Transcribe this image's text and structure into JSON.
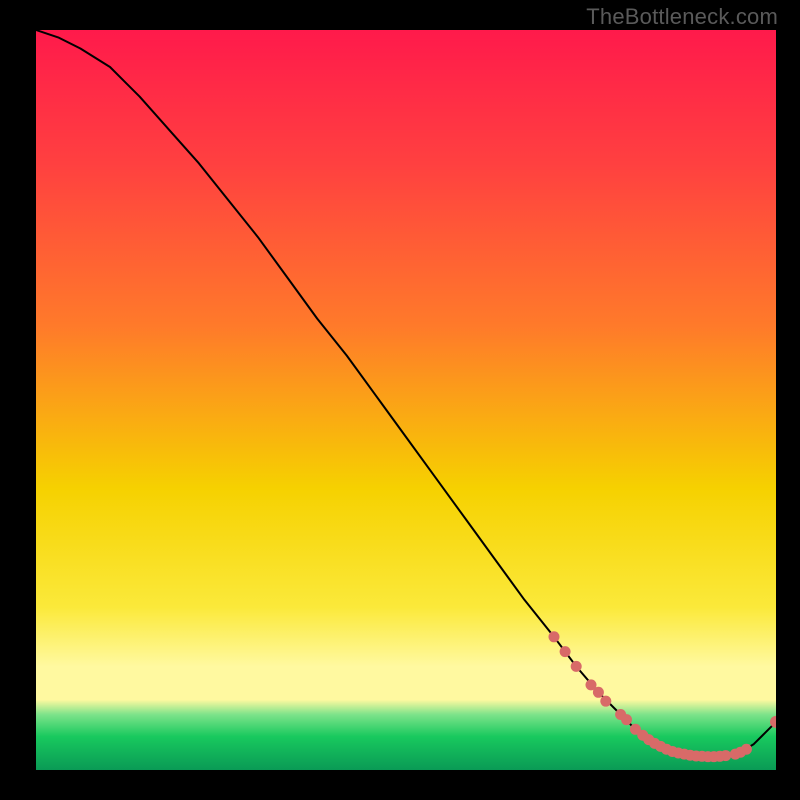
{
  "watermark": "TheBottleneck.com",
  "colors": {
    "background": "#000000",
    "line": "#000000",
    "point_fill": "#d86a68",
    "point_stroke": "#d86a68",
    "gradient_top": "#ff1a4b",
    "gradient_mid1": "#ff7a2a",
    "gradient_mid2": "#f6d100",
    "gradient_mid3": "#fff43a",
    "gradient_band": "#fff9a0",
    "gradient_green1": "#7de38a",
    "gradient_green2": "#18c95e",
    "gradient_green3": "#0a9a55"
  },
  "chart_data": {
    "type": "line",
    "title": "",
    "xlabel": "",
    "ylabel": "",
    "xlim": [
      0,
      100
    ],
    "ylim": [
      0,
      100
    ],
    "grid": false,
    "legend": false,
    "series": [
      {
        "name": "curve",
        "x": [
          0,
          3,
          6,
          10,
          14,
          18,
          22,
          26,
          30,
          34,
          38,
          42,
          46,
          50,
          54,
          58,
          62,
          66,
          70,
          73,
          76,
          79,
          81,
          83,
          85,
          87,
          89,
          91,
          93,
          95,
          97,
          99,
          100
        ],
        "y": [
          100,
          99,
          97.5,
          95,
          91,
          86.5,
          82,
          77,
          72,
          66.5,
          61,
          56,
          50.5,
          45,
          39.5,
          34,
          28.5,
          23,
          18,
          14,
          10.5,
          7.5,
          5.5,
          4,
          3,
          2.3,
          1.9,
          1.7,
          1.8,
          2.3,
          3.5,
          5.5,
          6.5
        ]
      }
    ],
    "points": [
      {
        "x": 70,
        "y": 18
      },
      {
        "x": 71.5,
        "y": 16
      },
      {
        "x": 73,
        "y": 14
      },
      {
        "x": 75,
        "y": 11.5
      },
      {
        "x": 76,
        "y": 10.5
      },
      {
        "x": 77,
        "y": 9.3
      },
      {
        "x": 79,
        "y": 7.5
      },
      {
        "x": 79.8,
        "y": 6.8
      },
      {
        "x": 81,
        "y": 5.5
      },
      {
        "x": 82,
        "y": 4.7
      },
      {
        "x": 82.8,
        "y": 4.1
      },
      {
        "x": 83.6,
        "y": 3.6
      },
      {
        "x": 84.4,
        "y": 3.2
      },
      {
        "x": 85.2,
        "y": 2.8
      },
      {
        "x": 86,
        "y": 2.5
      },
      {
        "x": 86.8,
        "y": 2.3
      },
      {
        "x": 87.6,
        "y": 2.15
      },
      {
        "x": 88.4,
        "y": 2.0
      },
      {
        "x": 89.2,
        "y": 1.9
      },
      {
        "x": 90,
        "y": 1.85
      },
      {
        "x": 90.8,
        "y": 1.8
      },
      {
        "x": 91.6,
        "y": 1.8
      },
      {
        "x": 92.4,
        "y": 1.85
      },
      {
        "x": 93.2,
        "y": 1.95
      },
      {
        "x": 94.5,
        "y": 2.15
      },
      {
        "x": 95.2,
        "y": 2.4
      },
      {
        "x": 96,
        "y": 2.8
      },
      {
        "x": 100,
        "y": 6.5
      }
    ]
  }
}
